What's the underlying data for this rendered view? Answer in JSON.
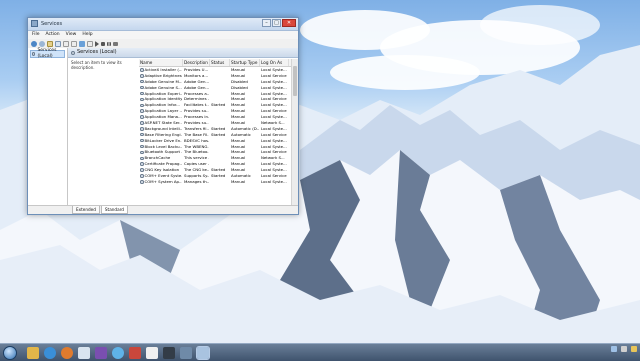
{
  "window": {
    "title": "Services",
    "buttons": {
      "minimize": "–",
      "maximize": "□",
      "close": "✕"
    },
    "menu": [
      "File",
      "Action",
      "View",
      "Help"
    ],
    "tree_item": "Services (Local)",
    "pane_title": "Services (Local)",
    "description_prompt": "Select an item to view its description.",
    "columns": [
      "Name",
      "Description",
      "Status",
      "Startup Type",
      "Log On As"
    ],
    "rows": [
      [
        "ActiveX Installer (...",
        "Provides U...",
        "",
        "Manual",
        "Local Syste..."
      ],
      [
        "Adaptive Brightness",
        "Monitors a...",
        "",
        "Manual",
        "Local Service"
      ],
      [
        "Adobe Genuine M...",
        "Adobe Gen...",
        "",
        "Disabled",
        "Local Syste..."
      ],
      [
        "Adobe Genuine S...",
        "Adobe Gen...",
        "",
        "Disabled",
        "Local Syste..."
      ],
      [
        "Application Experi...",
        "Processes a...",
        "",
        "Manual",
        "Local Syste..."
      ],
      [
        "Application Identity",
        "Determines ...",
        "",
        "Manual",
        "Local Service"
      ],
      [
        "Application Infor...",
        "Facilitates t...",
        "Started",
        "Manual",
        "Local Syste..."
      ],
      [
        "Application Layer ...",
        "Provides su...",
        "",
        "Manual",
        "Local Service"
      ],
      [
        "Application Mana...",
        "Processes in...",
        "",
        "Manual",
        "Local Syste..."
      ],
      [
        "ASP.NET State Ser...",
        "Provides su...",
        "",
        "Manual",
        "Network S..."
      ],
      [
        "Background Intelli...",
        "Transfers fil...",
        "Started",
        "Automatic (D...",
        "Local Syste..."
      ],
      [
        "Base Filtering Engi...",
        "The Base Fil...",
        "Started",
        "Automatic",
        "Local Service"
      ],
      [
        "BitLocker Drive En...",
        "BDESVC hos...",
        "",
        "Manual",
        "Local Syste..."
      ],
      [
        "Block Level Backu...",
        "The WBENG...",
        "",
        "Manual",
        "Local Syste..."
      ],
      [
        "Bluetooth Support ...",
        "The Bluetoo...",
        "",
        "Manual",
        "Local Service"
      ],
      [
        "BranchCache",
        "This service ...",
        "",
        "Manual",
        "Network S..."
      ],
      [
        "Certificate Propag...",
        "Copies user ...",
        "",
        "Manual",
        "Local Syste..."
      ],
      [
        "CNG Key Isolation",
        "The CNG ke...",
        "Started",
        "Manual",
        "Local Syste..."
      ],
      [
        "COM+ Event Syste...",
        "Supports Sy...",
        "Started",
        "Automatic",
        "Local Service"
      ],
      [
        "COM+ System Ap...",
        "Manages th...",
        "",
        "Manual",
        "Local Syste..."
      ]
    ],
    "tabs": [
      "Extended",
      "Standard"
    ]
  },
  "taskbar": {
    "icons": [
      "explorer-icon",
      "chrome-icon",
      "firefox-icon",
      "notepad-icon",
      "media-icon",
      "wifi-icon",
      "paint-icon",
      "search-icon",
      "terminal-icon",
      "settings-icon",
      "services-icon"
    ]
  },
  "colors": {
    "accent": "#2f6fb0",
    "close": "#d9473b",
    "taskbar": "#3f536d"
  }
}
